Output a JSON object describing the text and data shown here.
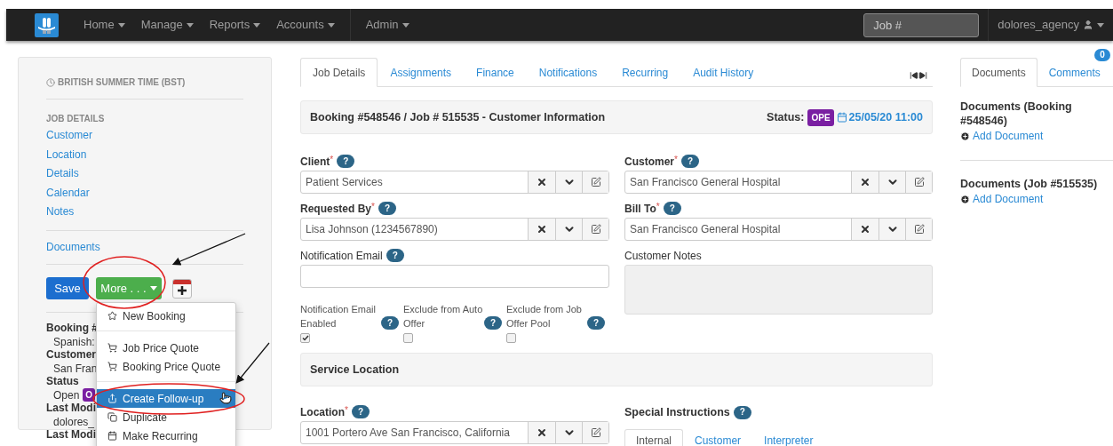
{
  "navbar": {
    "menus": [
      {
        "label": "Home"
      },
      {
        "label": "Manage"
      },
      {
        "label": "Reports"
      },
      {
        "label": "Accounts"
      }
    ],
    "admin_menu": {
      "label": "Admin"
    },
    "search": {
      "placeholder": "Job #"
    },
    "user": {
      "label": "dolores_agency"
    }
  },
  "sidebar": {
    "timezone": "BRITISH SUMMER TIME (BST)",
    "section_title": "JOB DETAILS",
    "link_groups": [
      [
        "Customer",
        "Location",
        "Details",
        "Calendar",
        "Notes"
      ],
      [
        "Documents"
      ]
    ],
    "save_button": "Save",
    "more_button": "More . . .",
    "info": [
      {
        "label": "Booking #",
        "value": "Spanish:"
      },
      {
        "label": "Customer",
        "value": "San Fran"
      },
      {
        "label": "Status",
        "value": "Open",
        "badge": "O"
      },
      {
        "label": "Last Modi",
        "value": "dolores_"
      },
      {
        "label": "Last Modi"
      }
    ],
    "dropdown": {
      "groups": [
        [
          {
            "label": "New Booking",
            "selected": false
          }
        ],
        [
          {
            "label": "Job Price Quote",
            "selected": false
          },
          {
            "label": "Booking Price Quote",
            "selected": false
          }
        ],
        [
          {
            "label": "Create Follow-up",
            "selected": true
          },
          {
            "label": "Duplicate",
            "selected": false
          },
          {
            "label": "Make Recurring",
            "selected": false
          }
        ]
      ]
    }
  },
  "main": {
    "tabs": [
      {
        "label": "Job Details",
        "selected": true
      },
      {
        "label": "Assignments",
        "selected": false
      },
      {
        "label": "Finance",
        "selected": false
      },
      {
        "label": "Notifications",
        "selected": false
      },
      {
        "label": "Recurring",
        "selected": false
      },
      {
        "label": "Audit History",
        "selected": false
      }
    ],
    "header": {
      "title": "Booking #548546 / Job # 515535 - Customer Information",
      "status_label": "Status:",
      "status_badge": "OPE",
      "date": "25/05/20 11:00"
    },
    "left_fields": [
      {
        "label": "Client",
        "required_mark": "*",
        "help": "?",
        "value": "Patient Services",
        "kind": "select"
      },
      {
        "label": "Requested By",
        "required_mark": "*",
        "help": "?",
        "value": "Lisa Johnson (1234567890)",
        "kind": "select"
      },
      {
        "label": "Notification Email",
        "help": "?",
        "kind": "text"
      }
    ],
    "checkboxes": [
      {
        "label": "Notification Email Enabled",
        "help": "?",
        "checked": true
      },
      {
        "label": "Exclude from Auto Offer",
        "help": "?",
        "checked": false
      },
      {
        "label": "Exclude from Job Offer Pool",
        "help": "?",
        "checked": false
      }
    ],
    "right_fields": [
      {
        "label": "Customer",
        "required_mark": "*",
        "help": "?",
        "value": "San Francisco General Hospital",
        "kind": "select"
      },
      {
        "label": "Bill To",
        "required_mark": "*",
        "help": "?",
        "value": "San Francisco General Hospital",
        "kind": "select"
      },
      {
        "label": "Customer Notes",
        "kind": "textarea",
        "disabled": true
      }
    ],
    "service_location": {
      "title": "Service Location"
    },
    "location_field": {
      "label": "Location",
      "required_mark": "*",
      "help": "?",
      "value": "1001 Portero Ave San Francisco, California",
      "kind": "select"
    },
    "special_instructions": {
      "label": "Special Instructions",
      "help": "?",
      "tabs": [
        {
          "label": "Internal",
          "selected": true
        },
        {
          "label": "Customer",
          "selected": false
        },
        {
          "label": "Interpreter",
          "selected": false
        }
      ]
    }
  },
  "right_panel": {
    "tabs": [
      {
        "label": "Documents",
        "selected": true
      },
      {
        "label": "Comments",
        "selected": false,
        "badge": "0"
      }
    ],
    "sections": [
      {
        "title": "Documents (Booking #548546)",
        "link": "Add Document"
      },
      {
        "title": "Documents (Job #515535)",
        "link": "Add Document"
      }
    ]
  }
}
